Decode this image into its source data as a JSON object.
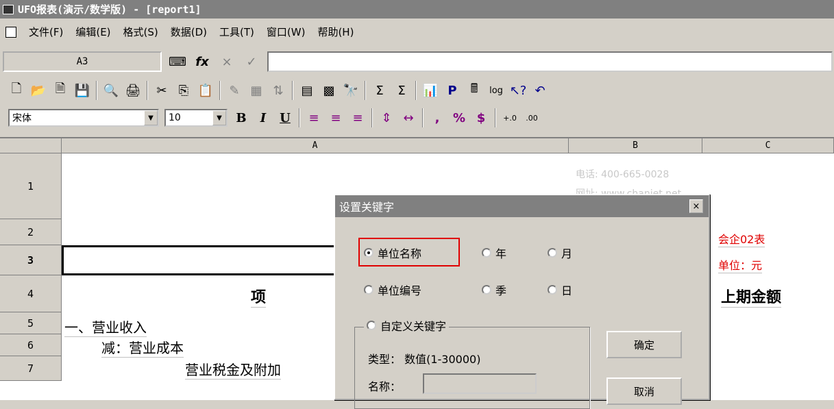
{
  "window": {
    "title": "UFO报表(演示/数学版) - [report1]"
  },
  "menu": [
    "文件(F)",
    "编辑(E)",
    "格式(S)",
    "数据(D)",
    "工具(T)",
    "窗口(W)",
    "帮助(H)"
  ],
  "formula_bar": {
    "cell_ref": "A3",
    "fx_label": "fx",
    "cancel_icon": "×",
    "confirm_icon": "✓"
  },
  "toolbar2": {
    "font": "宋体",
    "size": "10",
    "bold": "B",
    "italic": "I",
    "underline": "U",
    "comma": ",",
    "percent": "%",
    "currency": "$"
  },
  "grid": {
    "columns": [
      "A",
      "B",
      "C"
    ],
    "rows": [
      "1",
      "2",
      "3",
      "4",
      "5",
      "6",
      "7"
    ],
    "cells": {
      "c2_text": "会企02表",
      "c3_text": "单位：元",
      "a4_text": "项",
      "c4_text": "上期金额",
      "a5_text": "一、营业收入",
      "a6_text": "减：营业成本",
      "a7_text": "营业税金及附加"
    }
  },
  "dialog": {
    "title": "设置关键字",
    "close": "×",
    "options": {
      "unit_name": "单位名称",
      "year": "年",
      "month": "月",
      "unit_code": "单位编号",
      "quarter": "季",
      "day": "日",
      "custom": "自定义关键字"
    },
    "type_label": "类型：",
    "type_value": "数值(1-30000)",
    "name_label": "名称：",
    "ok": "确定",
    "cancel": "取消"
  },
  "watermark": {
    "phone": "电话: 400-665-0028",
    "site": "网址: www.chanjet.net"
  },
  "colors": {
    "highlight": "#e00000",
    "title_bg": "#808080"
  }
}
